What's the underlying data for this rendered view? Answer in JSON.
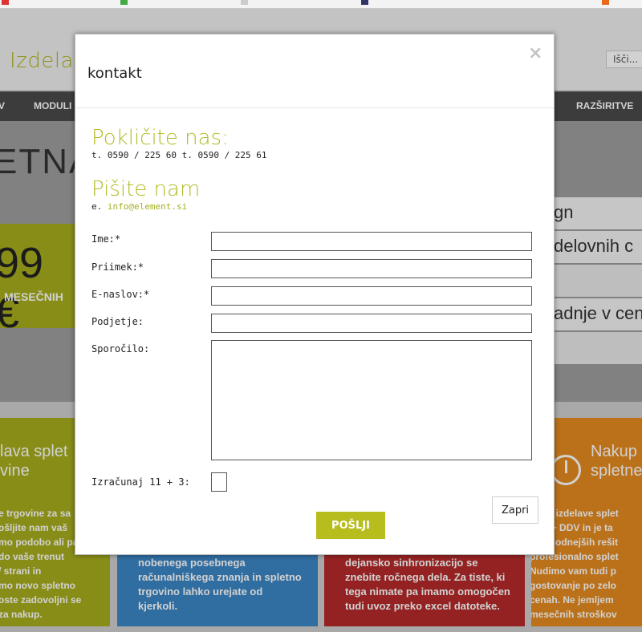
{
  "colors": {
    "accent": "#b4bd2a",
    "send_button": "#b6bd1c",
    "nav_bg": "#4a4a4a",
    "box_green": "#a7ad1e",
    "box_blue": "#3b86c4",
    "box_red": "#b52a2a",
    "box_orange": "#e58a1f"
  },
  "site": {
    "logo": "Izdelav",
    "search_placeholder": "Išči...",
    "nav": {
      "left_fragment": "V",
      "moduli": "MODULI",
      "razsiritve": "RAZŠIRITVE"
    },
    "hero_title": "ETNA",
    "price": {
      "value": "99 €",
      "label": "MESEČNIH"
    },
    "features": [
      "gn",
      "delovnih c",
      "adnje v cen"
    ],
    "boxes": [
      {
        "title": "lava splet\nvine",
        "text": "e trgovine za sa\nošljite nam vaš\nmo podobo ali pa\n do vaše trenut\n/ strani in\nmo novo spletno\noste zadovoljni se\nza nakup."
      },
      {
        "text": "nobenega posebnega\nračunalniškega znanja in spletno\ntrgovino lahko urejate od\nkjerkoli."
      },
      {
        "text": "dejansko sinhronizacijo se\nznebite ročnega dela. Za tiste, ki\ntega nimate pa imamo omogočen\ntudi uvoz preko excel datoteke."
      },
      {
        "title": "Nakup\nspletne",
        "text": "Cena izdelave splet\n99 € + DDV in je ta\nnajugodnejših rešit\nprofesionalno splet\nNudimo vam tudi p\ngostovanje po zelo\ncenah. Ne jemljem\nmesečnih stroškov"
      }
    ]
  },
  "modal": {
    "title": "kontakt",
    "close_glyph": "×",
    "call": {
      "heading": "Pokličite nas:",
      "phones": "t. 0590 / 225 60 t. 0590 / 225 61"
    },
    "write": {
      "heading": "Pišite nam",
      "email_prefix": "e.",
      "email": "info@element.si"
    },
    "form": {
      "ime_label": "Ime:*",
      "priimek_label": "Priimek:*",
      "email_label": "E-naslov:*",
      "podjetje_label": "Podjetje:",
      "sporocilo_label": "Sporočilo:",
      "captcha_label": "Izračunaj 11 + 3:"
    },
    "buttons": {
      "send": "POŠLJI",
      "close": "Zapri"
    }
  }
}
